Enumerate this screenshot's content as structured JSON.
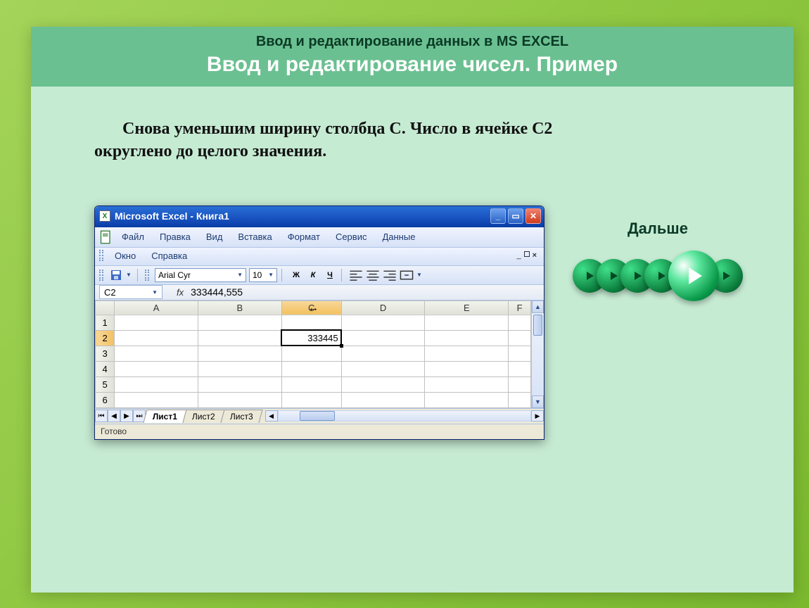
{
  "slide": {
    "subtitle": "Ввод и редактирование данных в MS EXCEL",
    "title": "Ввод  и  редактирование  чисел.  Пример",
    "body_prefix": "Снова уменьшим ширину столбца С. Число в ячейке С2",
    "body_suffix": "округлено до целого значения."
  },
  "nav": {
    "next_label": "Дальше"
  },
  "excel": {
    "window_title": "Microsoft Excel - Книга1",
    "menu": {
      "file": "Файл",
      "edit": "Правка",
      "view": "Вид",
      "insert": "Вставка",
      "format": "Формат",
      "tools": "Сервис",
      "data": "Данные",
      "window": "Окно",
      "help": "Справка"
    },
    "toolbar": {
      "font_name": "Arial Cyr",
      "font_size": "10",
      "bold": "Ж",
      "italic": "К",
      "underline": "Ч"
    },
    "formula": {
      "cell_ref": "C2",
      "fx_label": "fx",
      "value": "333444,555"
    },
    "columns": [
      "A",
      "B",
      "C",
      "D",
      "E",
      "F"
    ],
    "rows": [
      "1",
      "2",
      "3",
      "4",
      "5",
      "6"
    ],
    "selected_display": "333445",
    "sheets": {
      "sheet1": "Лист1",
      "sheet2": "Лист2",
      "sheet3": "Лист3"
    },
    "status": "Готово"
  }
}
